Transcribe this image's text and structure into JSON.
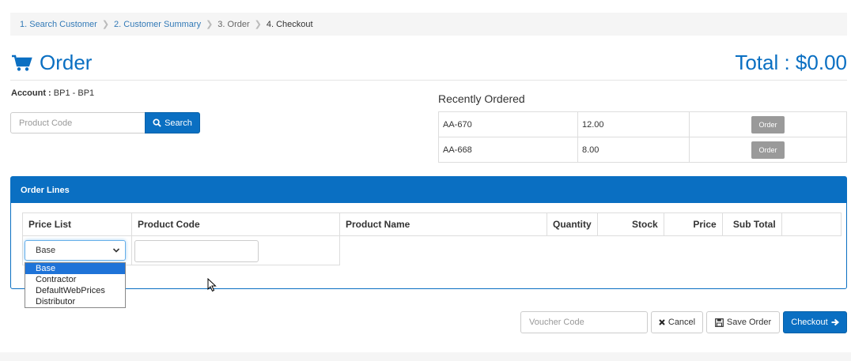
{
  "breadcrumb": {
    "step1": "1. Search Customer",
    "step2": "2. Customer Summary",
    "step3": "3. Order",
    "step4": "4. Checkout"
  },
  "header": {
    "title": "Order",
    "total": "Total : $0.00",
    "icon": "shopping-cart-icon"
  },
  "account": {
    "label": "Account :",
    "value": " BP1 - BP1"
  },
  "search": {
    "placeholder": "Product Code",
    "button_label": "Search"
  },
  "recently_ordered": {
    "title": "Recently Ordered",
    "rows": [
      {
        "code": "AA-670",
        "qty": "12.00",
        "button": "Order"
      },
      {
        "code": "AA-668",
        "qty": "8.00",
        "button": "Order"
      }
    ]
  },
  "order_lines": {
    "title": "Order Lines",
    "columns": [
      "Price List",
      "Product Code",
      "Product Name",
      "Quantity",
      "Stock",
      "Price",
      "Sub Total"
    ],
    "price_list_selected": "Base",
    "price_list_options": [
      "Base",
      "Contractor",
      "DefaultWebPrices",
      "Distributor"
    ]
  },
  "footer_actions": {
    "voucher_placeholder": "Voucher Code",
    "cancel_label": "Cancel",
    "save_label": "Save Order",
    "checkout_label": "Checkout"
  },
  "colors": {
    "accent": "#0a6fc2",
    "selection": "#1e73d8",
    "disabled_button": "#9a9a9a"
  }
}
